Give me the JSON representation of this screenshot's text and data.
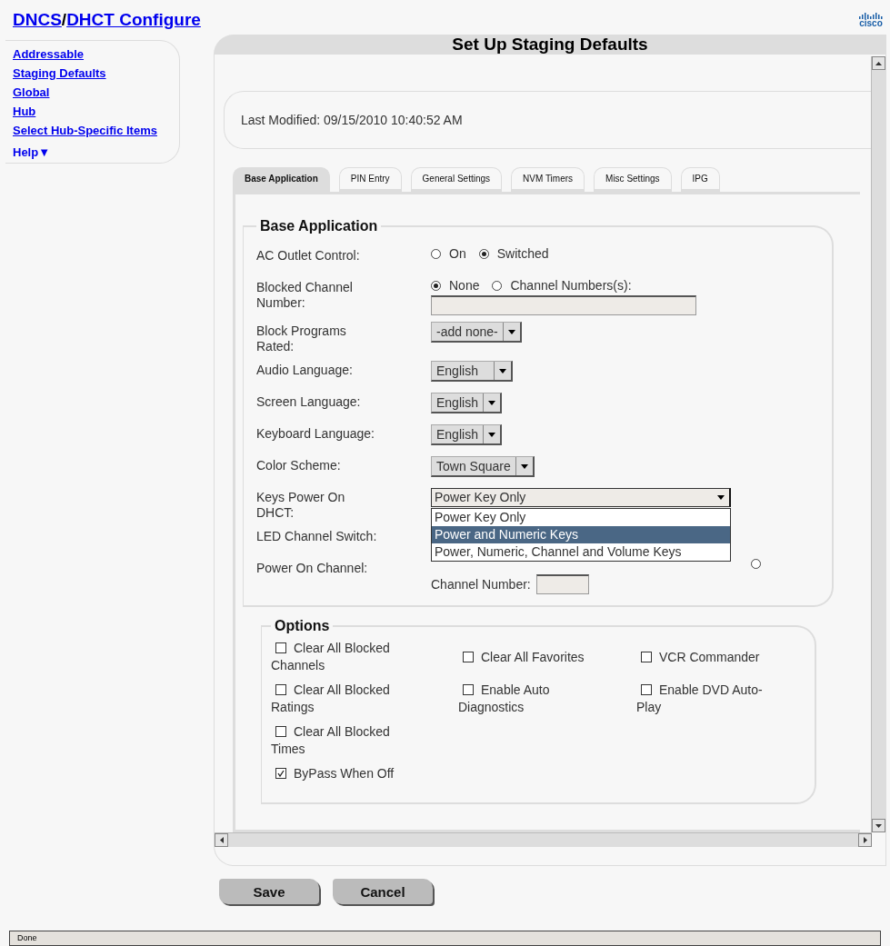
{
  "header": {
    "title_links": [
      "DNCS",
      "DHCT Configure"
    ],
    "separator": "/",
    "logo_text": "cisco"
  },
  "sidebar": {
    "items": [
      {
        "label": "Addressable"
      },
      {
        "label": "Staging Defaults"
      },
      {
        "label": "Global"
      },
      {
        "label": "Hub"
      },
      {
        "label": "Select Hub-Specific Items"
      }
    ],
    "help": {
      "label": "Help",
      "arrow": "▼"
    }
  },
  "panel": {
    "title": "Set Up Staging Defaults",
    "last_modified": "Last Modified: 09/15/2010 10:40:52 AM",
    "tabs": [
      {
        "label": "Base Application",
        "selected": true
      },
      {
        "label": "PIN Entry",
        "selected": false
      },
      {
        "label": "General Settings",
        "selected": false
      },
      {
        "label": "NVM Timers",
        "selected": false
      },
      {
        "label": "Misc Settings",
        "selected": false
      },
      {
        "label": "IPG",
        "selected": false
      }
    ],
    "section_title": "Base Application",
    "fields": [
      {
        "kind": "radio",
        "label": "AC Outlet Control:",
        "options": [
          {
            "label": "On",
            "selected": false
          },
          {
            "label": "Switched",
            "selected": true
          }
        ]
      },
      {
        "kind": "radio_text",
        "label": "Blocked Channel Number:",
        "options": [
          {
            "label": "None",
            "selected": true
          },
          {
            "label": "Channel Numbers(s):",
            "selected": false
          }
        ]
      },
      {
        "kind": "select",
        "label": "Block Programs Rated:",
        "value": "-add none-"
      },
      {
        "kind": "select",
        "label": "Audio Language:",
        "value": "English   "
      },
      {
        "kind": "select",
        "label": "Screen Language:",
        "value": "English"
      },
      {
        "kind": "select",
        "label": "Keyboard Language:",
        "value": "English"
      },
      {
        "kind": "select",
        "label": "Color Scheme:",
        "value": "Town Square"
      },
      {
        "kind": "dropdown_open",
        "label": "Keys Power On DHCT:",
        "value": "Power Key Only",
        "options": [
          {
            "label": "Power Key Only",
            "highlighted": false
          },
          {
            "label": "Power and Numeric Keys",
            "highlighted": true
          },
          {
            "label": "Power, Numeric, Channel and Volume Keys",
            "highlighted": false
          }
        ]
      },
      {
        "kind": "covered",
        "label": "LED Channel Switch:"
      },
      {
        "kind": "covered_radio",
        "label": "Power On Channel:",
        "radio_selected": false,
        "number_label": "Channel Number:"
      }
    ],
    "options_title": "Options",
    "option_rows": [
      [
        {
          "label": "Clear All Blocked Channels",
          "checked": false
        },
        {
          "label": "Clear All Favorites",
          "checked": false
        },
        {
          "label": "VCR Commander",
          "checked": false
        }
      ],
      [
        {
          "label": "Clear All Blocked Ratings",
          "checked": false
        },
        {
          "label": "Enable Auto Diagnostics",
          "checked": false
        },
        {
          "label": "Enable DVD Auto-Play",
          "checked": false
        }
      ],
      [
        {
          "label": "Clear All Blocked Times",
          "checked": false
        }
      ],
      [
        {
          "label": "ByPass When Off",
          "checked": true
        }
      ]
    ]
  },
  "buttons": [
    {
      "label": "Save"
    },
    {
      "label": "Cancel"
    }
  ],
  "status_bar": {
    "text": "Done"
  }
}
